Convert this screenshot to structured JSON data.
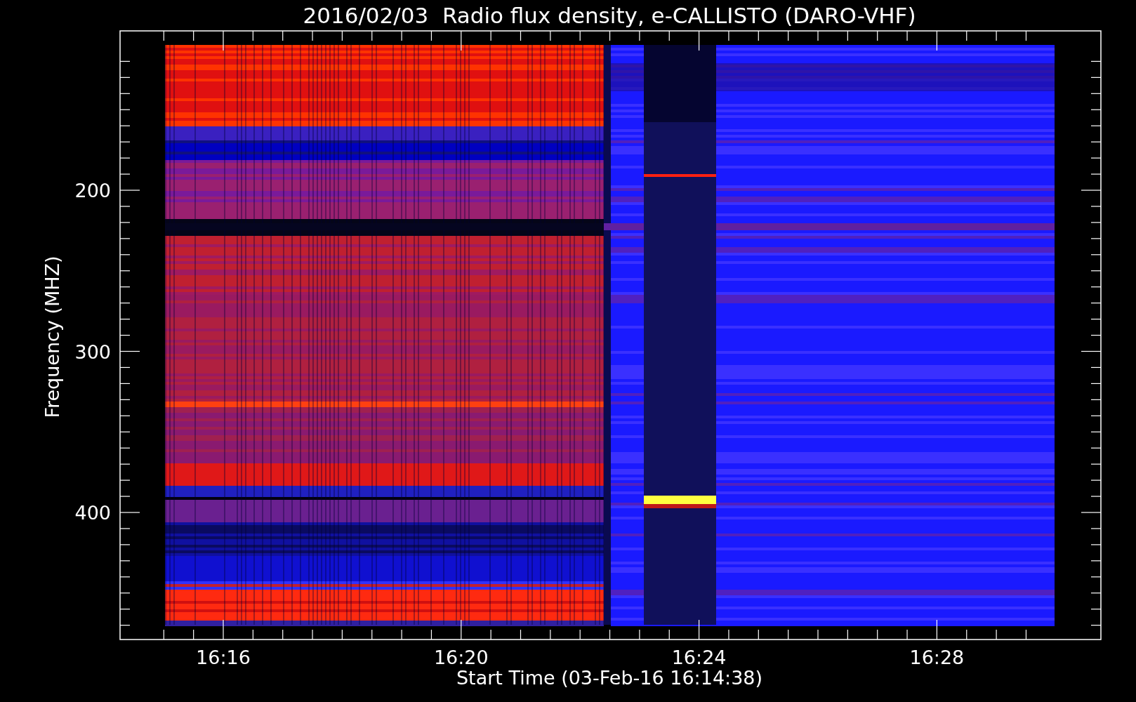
{
  "title": "2016/02/03  Radio flux density, e-CALLISTO (DARO-VHF)",
  "y_axis": {
    "label": "Frequency (MHZ)",
    "tick_labels": [
      "200",
      "300",
      "400"
    ]
  },
  "x_axis": {
    "label": "Start Time (03-Feb-16 16:14:38)",
    "tick_labels": [
      "16:16",
      "16:20",
      "16:24",
      "16:28"
    ]
  }
}
